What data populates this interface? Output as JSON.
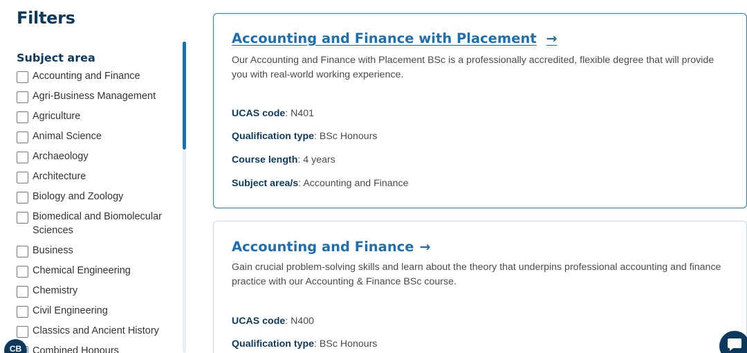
{
  "filters": {
    "title": "Filters",
    "subject_area_title": "Subject area",
    "items": [
      {
        "label": "Accounting and Finance"
      },
      {
        "label": "Agri-Business Management"
      },
      {
        "label": "Agriculture"
      },
      {
        "label": "Animal Science"
      },
      {
        "label": "Archaeology"
      },
      {
        "label": "Architecture"
      },
      {
        "label": "Biology and Zoology"
      },
      {
        "label": "Biomedical and Biomolecular Sciences"
      },
      {
        "label": "Business"
      },
      {
        "label": "Chemical Engineering"
      },
      {
        "label": "Chemistry"
      },
      {
        "label": "Civil Engineering"
      },
      {
        "label": "Classics and Ancient History"
      },
      {
        "label": "Combined Honours"
      }
    ]
  },
  "courses": [
    {
      "title": "Accounting and Finance with Placement",
      "arrow": "→",
      "description": "Our Accounting and Finance with Placement BSc is a professionally accredited, flexible degree that will provide you with real-world working experience.",
      "ucas_label": "UCAS code",
      "ucas_value": ": N401",
      "qual_label": "Qualification type",
      "qual_value": ": BSc Honours",
      "length_label": "Course length",
      "length_value": ": 4 years",
      "subject_label": "Subject area/s",
      "subject_value": ": Accounting and Finance"
    },
    {
      "title": "Accounting and Finance",
      "arrow": "→",
      "description": "Gain crucial problem-solving skills and learn about the theory that underpins professional accounting and finance practice with our Accounting & Finance BSc course.",
      "ucas_label": "UCAS code",
      "ucas_value": ": N400",
      "qual_label": "Qualification type",
      "qual_value": ": BSc Honours"
    }
  ],
  "chat_left_text": "CB",
  "colors": {
    "accent": "#1f6fb0",
    "heading": "#0d3a5c",
    "card_border_active": "#2a77b5"
  }
}
